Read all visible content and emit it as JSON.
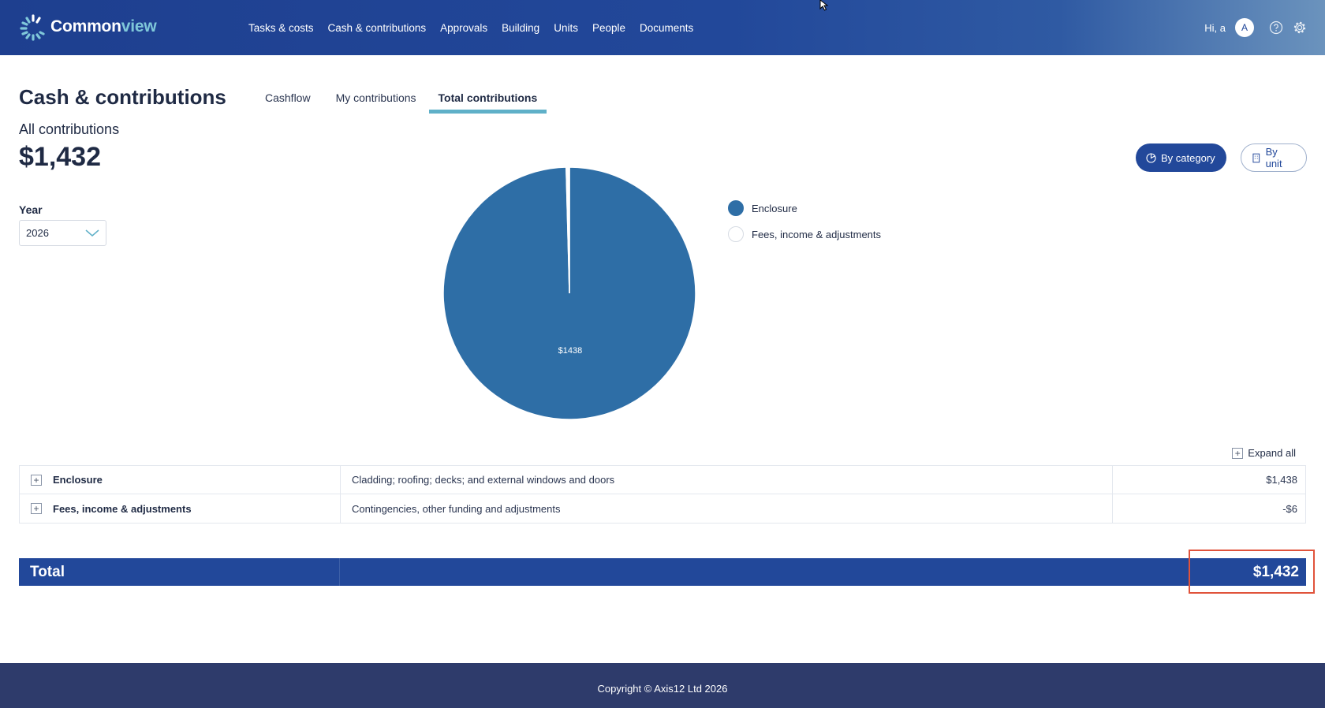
{
  "brand": {
    "name_bold": "Common",
    "name_light": "view"
  },
  "nav": [
    {
      "label": "Tasks & costs"
    },
    {
      "label": "Cash & contributions"
    },
    {
      "label": "Approvals"
    },
    {
      "label": "Building"
    },
    {
      "label": "Units"
    },
    {
      "label": "People"
    },
    {
      "label": "Documents"
    }
  ],
  "user": {
    "greeting": "Hi, a",
    "avatar_initial": "A"
  },
  "page": {
    "title": "Cash & contributions"
  },
  "tabs": [
    {
      "label": "Cashflow",
      "active": false
    },
    {
      "label": "My contributions",
      "active": false
    },
    {
      "label": "Total contributions",
      "active": true
    }
  ],
  "summary": {
    "subtitle": "All contributions",
    "total": "$1,432"
  },
  "filters": {
    "year_label": "Year",
    "year_value": "2026"
  },
  "view_toggle": {
    "by_category": "By category",
    "by_unit": "By unit"
  },
  "chart_data": {
    "type": "pie",
    "slices": [
      {
        "label": "Enclosure",
        "value": 1438,
        "color": "#2e6ea6",
        "data_label": "$1438"
      },
      {
        "label": "Fees, income & adjustments",
        "value": 6,
        "color": "#ffffff"
      }
    ]
  },
  "table": {
    "expand_all": "Expand all",
    "rows": [
      {
        "name": "Enclosure",
        "description": "Cladding; roofing; decks; and external windows and doors",
        "amount": "$1,438"
      },
      {
        "name": "Fees, income & adjustments",
        "description": "Contingencies, other funding and adjustments",
        "amount": "-$6"
      }
    ],
    "total_label": "Total",
    "total_amount": "$1,432"
  },
  "footer": {
    "copyright": "Copyright © Axis12 Ltd 2026"
  }
}
